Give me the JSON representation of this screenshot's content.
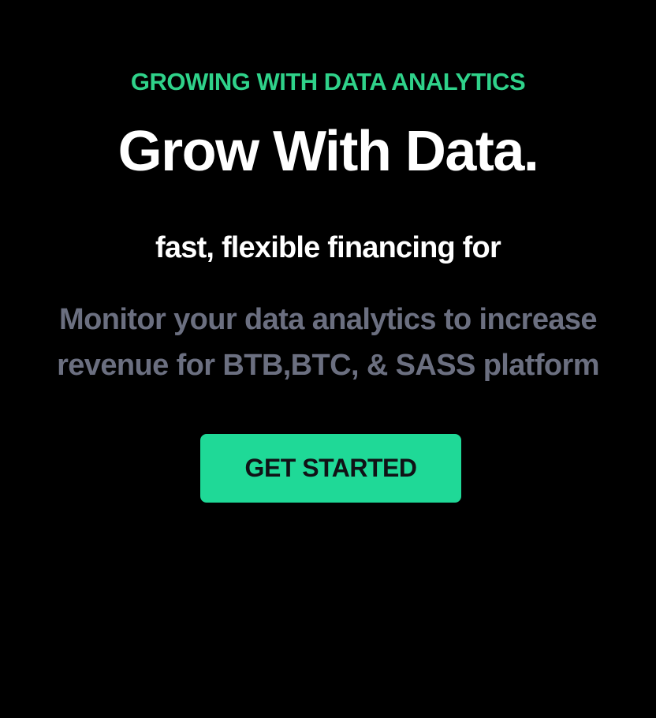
{
  "hero": {
    "eyebrow": "GROWING WITH DATA ANALYTICS",
    "title": "Grow With Data.",
    "tagline": "fast, flexible financing for",
    "description_line1": "Monitor your data analytics to increase",
    "description_line2": "revenue for BTB,BTC, & SASS platform",
    "cta_label": "GET STARTED"
  },
  "colors": {
    "background": "#000000",
    "accent": "#1fd997",
    "eyebrow": "#2fd28a",
    "muted_text": "#6b6f80",
    "title_text": "#ffffff"
  }
}
